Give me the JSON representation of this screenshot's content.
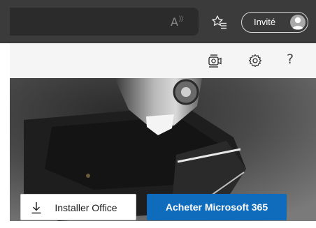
{
  "browser": {
    "profile_label": "Invité",
    "icons": [
      "read-aloud-icon",
      "favorites-icon",
      "avatar-icon"
    ]
  },
  "toolbar": {
    "icons": [
      "meeting-icon",
      "settings-gear-icon",
      "help-icon"
    ],
    "help_glyph": "?"
  },
  "hero": {
    "install_label": "Installer Office",
    "buy_label": "Acheter Microsoft 365"
  },
  "colors": {
    "chrome_background": "#3b3b3b",
    "toolbar_background": "#f5f5f5",
    "buy_button": "#0f6cbd",
    "install_button": "#ffffff"
  }
}
